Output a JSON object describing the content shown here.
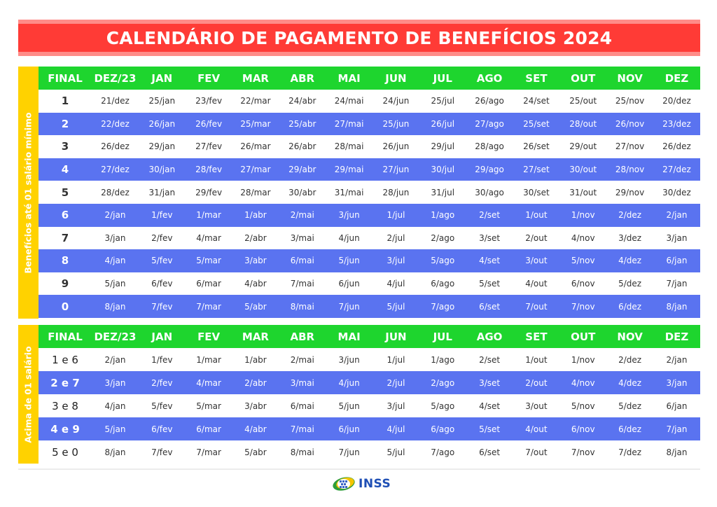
{
  "title": "CALENDÁRIO DE PAGAMENTO DE BENEFÍCIOS 2024",
  "colors": {
    "title_bg": "#ff3b36",
    "title_border": "#ff8c88",
    "header_bg": "#1ed52e",
    "side_label_bg": "#ffd200",
    "row_highlight": "#5a73f0",
    "logo_text": "#1f4fb5"
  },
  "columns": [
    "FINAL",
    "DEZ/23",
    "JAN",
    "FEV",
    "MAR",
    "ABR",
    "MAI",
    "JUN",
    "JUL",
    "AGO",
    "SET",
    "OUT",
    "NOV",
    "DEZ"
  ],
  "section1": {
    "side_label": "Benefícios até 01 salário mínimo",
    "rows": [
      {
        "final": "1",
        "dates": [
          "21/dez",
          "25/jan",
          "23/fev",
          "22/mar",
          "24/abr",
          "24/mai",
          "24/jun",
          "25/jul",
          "26/ago",
          "24/set",
          "25/out",
          "25/nov",
          "20/dez"
        ]
      },
      {
        "final": "2",
        "dates": [
          "22/dez",
          "26/jan",
          "26/fev",
          "25/mar",
          "25/abr",
          "27/mai",
          "25/jun",
          "26/jul",
          "27/ago",
          "25/set",
          "28/out",
          "26/nov",
          "23/dez"
        ]
      },
      {
        "final": "3",
        "dates": [
          "26/dez",
          "29/jan",
          "27/fev",
          "26/mar",
          "26/abr",
          "28/mai",
          "26/jun",
          "29/jul",
          "28/ago",
          "26/set",
          "29/out",
          "27/nov",
          "26/dez"
        ]
      },
      {
        "final": "4",
        "dates": [
          "27/dez",
          "30/jan",
          "28/fev",
          "27/mar",
          "29/abr",
          "29/mai",
          "27/jun",
          "30/jul",
          "29/ago",
          "27/set",
          "30/out",
          "28/nov",
          "27/dez"
        ]
      },
      {
        "final": "5",
        "dates": [
          "28/dez",
          "31/jan",
          "29/fev",
          "28/mar",
          "30/abr",
          "31/mai",
          "28/jun",
          "31/jul",
          "30/ago",
          "30/set",
          "31/out",
          "29/nov",
          "30/dez"
        ]
      },
      {
        "final": "6",
        "dates": [
          "2/jan",
          "1/fev",
          "1/mar",
          "1/abr",
          "2/mai",
          "3/jun",
          "1/jul",
          "1/ago",
          "2/set",
          "1/out",
          "1/nov",
          "2/dez",
          "2/jan"
        ]
      },
      {
        "final": "7",
        "dates": [
          "3/jan",
          "2/fev",
          "4/mar",
          "2/abr",
          "3/mai",
          "4/jun",
          "2/jul",
          "2/ago",
          "3/set",
          "2/out",
          "4/nov",
          "3/dez",
          "3/jan"
        ]
      },
      {
        "final": "8",
        "dates": [
          "4/jan",
          "5/fev",
          "5/mar",
          "3/abr",
          "6/mai",
          "5/jun",
          "3/jul",
          "5/ago",
          "4/set",
          "3/out",
          "5/nov",
          "4/dez",
          "6/jan"
        ]
      },
      {
        "final": "9",
        "dates": [
          "5/jan",
          "6/fev",
          "6/mar",
          "4/abr",
          "7/mai",
          "6/jun",
          "4/jul",
          "6/ago",
          "5/set",
          "4/out",
          "6/nov",
          "5/dez",
          "7/jan"
        ]
      },
      {
        "final": "0",
        "dates": [
          "8/jan",
          "7/fev",
          "7/mar",
          "5/abr",
          "8/mai",
          "7/jun",
          "5/jul",
          "7/ago",
          "6/set",
          "7/out",
          "7/nov",
          "6/dez",
          "8/jan"
        ]
      }
    ]
  },
  "section2": {
    "side_label": "Acima de 01 salário",
    "rows": [
      {
        "final": "1 e 6",
        "dates": [
          "2/jan",
          "1/fev",
          "1/mar",
          "1/abr",
          "2/mai",
          "3/jun",
          "1/jul",
          "1/ago",
          "2/set",
          "1/out",
          "1/nov",
          "2/dez",
          "2/jan"
        ]
      },
      {
        "final": "2 e 7",
        "dates": [
          "3/jan",
          "2/fev",
          "4/mar",
          "2/abr",
          "3/mai",
          "4/jun",
          "2/jul",
          "2/ago",
          "3/set",
          "2/out",
          "4/nov",
          "4/dez",
          "3/jan"
        ]
      },
      {
        "final": "3 e 8",
        "dates": [
          "4/jan",
          "5/fev",
          "5/mar",
          "3/abr",
          "6/mai",
          "5/jun",
          "3/jul",
          "5/ago",
          "4/set",
          "3/out",
          "5/nov",
          "5/dez",
          "6/jan"
        ]
      },
      {
        "final": "4 e 9",
        "dates": [
          "5/jan",
          "6/fev",
          "6/mar",
          "4/abr",
          "7/mai",
          "6/jun",
          "4/jul",
          "6/ago",
          "5/set",
          "4/out",
          "6/nov",
          "6/dez",
          "7/jan"
        ]
      },
      {
        "final": "5 e 0",
        "dates": [
          "8/jan",
          "7/fev",
          "7/mar",
          "5/abr",
          "8/mai",
          "7/jun",
          "5/jul",
          "7/ago",
          "6/set",
          "7/out",
          "7/nov",
          "7/dez",
          "8/jan"
        ]
      }
    ]
  },
  "footer": {
    "logo_text": "INSS",
    "logo_icon": "inss-logo-icon"
  }
}
